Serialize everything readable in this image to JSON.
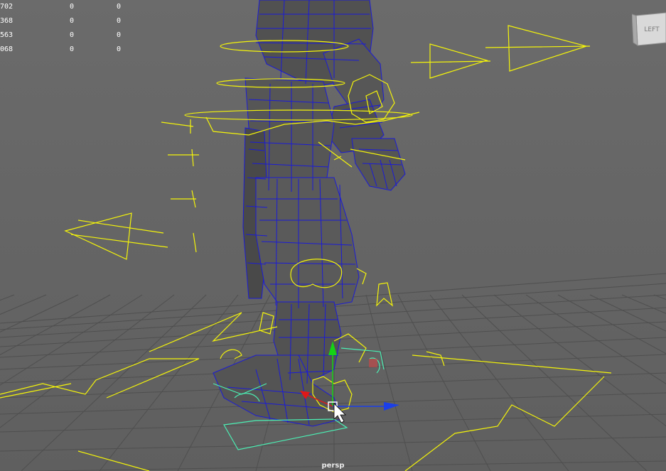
{
  "hud": {
    "rows": [
      {
        "name": "702",
        "a": "0",
        "b": "0"
      },
      {
        "name": "368",
        "a": "0",
        "b": "0"
      },
      {
        "name": "563",
        "a": "0",
        "b": "0"
      },
      {
        "name": "068",
        "a": "0",
        "b": "0"
      }
    ]
  },
  "viewcube": {
    "face_label": "LEFT"
  },
  "camera": {
    "name": "persp"
  },
  "colors": {
    "background": "#676767",
    "grid": "#505050",
    "mesh_wire": "#1b1bd6",
    "mesh_fill": "#4a4a4a",
    "controls": "#f4f40a",
    "selected_control": "#4bf0b4",
    "axis_x": "#e11818",
    "axis_y": "#15d315",
    "axis_z": "#1b3fe8"
  },
  "icons": [
    "viewcube-icon",
    "move-manipulator-icon",
    "cursor-arrow-icon"
  ]
}
